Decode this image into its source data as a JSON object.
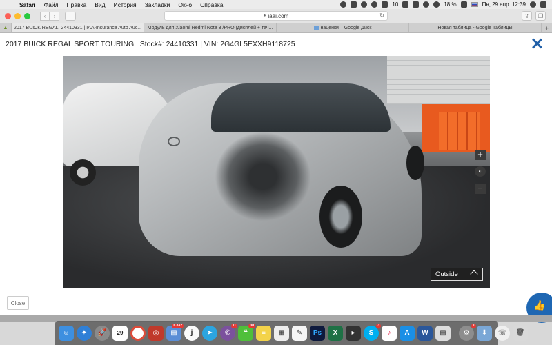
{
  "menubar": {
    "app": "Safari",
    "items": [
      "Файл",
      "Правка",
      "Вид",
      "История",
      "Закладки",
      "Окно",
      "Справка"
    ],
    "battery": "18 %",
    "datetime": "Пн, 29 апр.  12:39",
    "notif_count": "10"
  },
  "toolbar": {
    "address": "iaai.com"
  },
  "tabs": [
    {
      "label": "2017 BUICK REGAL, 24410331 | IAA-Insurance Auto Auc...",
      "active": true
    },
    {
      "label": "Модуль для Xiaomi Redmi Note 3 /PRO (дисплей + тач...",
      "active": false
    },
    {
      "label": "наценки – Google Диск",
      "active": false
    },
    {
      "label": "Новая таблица - Google Таблицы",
      "active": false
    }
  ],
  "modal": {
    "title": "2017 BUICK REGAL SPORT TOURING | Stock#: 24410331 | VIN: 2G4GL5EXXH9118725",
    "view_mode": "Outside",
    "close_label": "Close"
  },
  "dock": {
    "calendar_day": "29",
    "badges": {
      "photos": "6 832",
      "viber": "11",
      "wechat": "30",
      "skype": "3",
      "sysprefs": "1"
    }
  },
  "colors": {
    "accent": "#1f5fa8",
    "fab": "#1f67b3"
  }
}
